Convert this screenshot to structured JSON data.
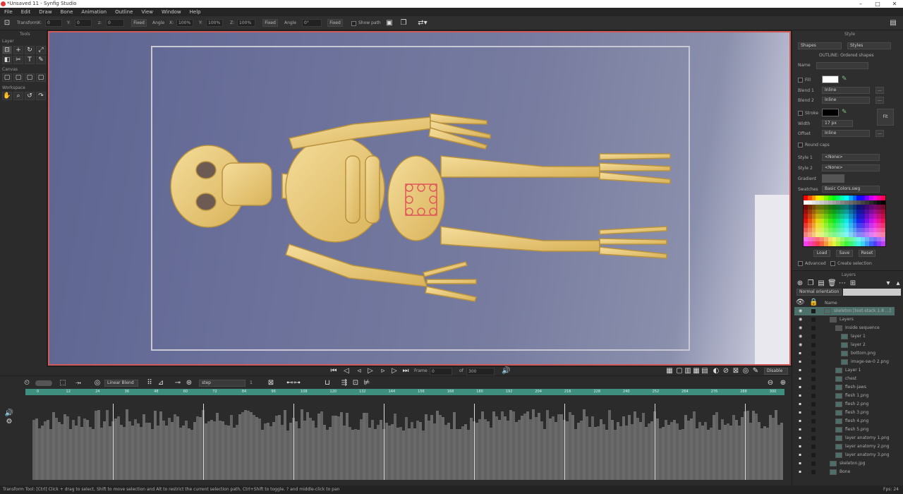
{
  "window": {
    "title": "*Unsaved 11 - Synfig Studio",
    "controls": [
      "–",
      "□",
      "✕"
    ]
  },
  "menu": [
    "File",
    "Edit",
    "Draw",
    "Bone",
    "Animation",
    "Outline",
    "View",
    "Window",
    "Help"
  ],
  "tool_options": {
    "tool_label": "Transform",
    "x_label": "X:",
    "x_value": "0",
    "y_label": "Y:",
    "y_value": "0",
    "center_btn": "Fixed",
    "angle_label": "Angle",
    "scale_x_label": "X:",
    "scale_x_value": "100%",
    "scale_y_label": "Y:",
    "scale_y_value": "100%",
    "scale_z_label": "Z:",
    "scale_z_value": "100%",
    "scale_btn": "Fixed",
    "rot_label": "Angle",
    "rot_value": "0°",
    "rot_btn": "Fixed",
    "show_path_label": "Show path"
  },
  "toolbox": {
    "header": "Tools",
    "sections": [
      "Layer",
      "Canvas",
      "Workspace"
    ]
  },
  "style_panel": {
    "header": "Style",
    "shapes_dd": "Shapes",
    "styles_dd": "Styles",
    "subtitle": "OUTLINE: Ordered shapes",
    "name_label": "Name",
    "fill_label": "Fill",
    "blend1_label": "Blend 1",
    "blend1_value": "Inline",
    "blend2_label": "Blend 2",
    "blend2_value": "Inline",
    "stroke_label": "Stroke",
    "width_label": "Width",
    "width_value": "17 px",
    "offset_label": "Offset",
    "offset_value": "Inline",
    "fit_btn": "Fit",
    "round_cap_label": "Round caps",
    "style1_label": "Style 1",
    "style1_value": "<None>",
    "style2_label": "Style 2",
    "style2_value": "<None>",
    "gradient_label": "Gradient",
    "swatches_label": "Swatches",
    "swatches_value": "Basic Colors.swg",
    "load_btn": "Load",
    "save_btn": "Save",
    "reset_btn": "Reset",
    "advanced_label": "Advanced",
    "create_selection_label": "Create selection"
  },
  "layers_panel": {
    "header": "Layers",
    "filter_dd": "Normal orientation",
    "col_name": "Name",
    "rows": [
      {
        "name": "skeleton [text-stack 1.8 ...]",
        "indent": 1,
        "selected": true,
        "eye": true
      },
      {
        "name": "Layers",
        "indent": 2,
        "eye": true,
        "folder": true
      },
      {
        "name": "Inside sequence",
        "indent": 3,
        "eye": true,
        "folder": true
      },
      {
        "name": "layer 1",
        "indent": 4,
        "eye": true
      },
      {
        "name": "layer 2",
        "indent": 4,
        "eye": true
      },
      {
        "name": "bottom.png",
        "indent": 4,
        "eye": false
      },
      {
        "name": "image-sw-0 2.png",
        "indent": 4,
        "eye": false
      },
      {
        "name": "Layer 1",
        "indent": 3,
        "eye": false
      },
      {
        "name": "chest",
        "indent": 3,
        "eye": false
      },
      {
        "name": "flesh-jaws",
        "indent": 3,
        "eye": false
      },
      {
        "name": "flesh 1.png",
        "indent": 3,
        "eye": false
      },
      {
        "name": "flesh 2.png",
        "indent": 3,
        "eye": false
      },
      {
        "name": "flesh 3.png",
        "indent": 3,
        "eye": false
      },
      {
        "name": "flesh 4.png",
        "indent": 3,
        "eye": false
      },
      {
        "name": "flesh 5.png",
        "indent": 3,
        "eye": false
      },
      {
        "name": "layer anatomy 1.png",
        "indent": 3,
        "eye": false
      },
      {
        "name": "layer anatomy 2.png",
        "indent": 3,
        "eye": false
      },
      {
        "name": "layer anatomy 3.png",
        "indent": 3,
        "eye": false
      },
      {
        "name": "skeleton.jpg",
        "indent": 2,
        "eye": false
      },
      {
        "name": "Bone",
        "indent": 2,
        "eye": false
      }
    ]
  },
  "playbar": {
    "frame_label": "Frame",
    "frame_value": "0",
    "end_label": "of",
    "end_value": "300",
    "quality_dd": "Disable"
  },
  "timeline": {
    "keyframe_dd": "Linear Blend",
    "step_dd": "step",
    "step_value": "1",
    "ruler_ticks": [
      "0",
      "12",
      "24",
      "36",
      "48",
      "60",
      "72",
      "84",
      "96",
      "108",
      "120",
      "132",
      "144",
      "156",
      "168",
      "180",
      "192",
      "204",
      "216",
      "228",
      "240",
      "252",
      "264",
      "276",
      "288",
      "300"
    ]
  },
  "statusbar": {
    "message": "Transform Tool: [Ctrl] Click + drag to select, Shift to move selection and Alt to restrict the current selection path, Ctrl+Shift to toggle. ? and middle-click to pan",
    "fps": "Fps: 24"
  },
  "colors": {
    "accent": "#3e8f7d",
    "canvas_border": "#d05a5a",
    "selected_row": "#4c6f69"
  }
}
